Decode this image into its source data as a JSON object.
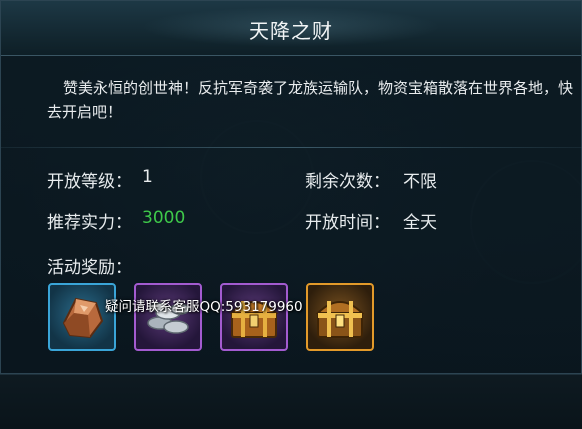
{
  "dialog": {
    "title": "天降之财",
    "description": "赞美永恒的创世神！反抗军奇袭了龙族运输队，物资宝箱散落在世界各地，快去开启吧！"
  },
  "info": {
    "open_level_label": "开放等级：",
    "open_level_value": "1",
    "remaining_label": "剩余次数：",
    "remaining_value": "不限",
    "power_label": "推荐实力：",
    "power_value": "3000",
    "time_label": "开放时间：",
    "time_value": "全天",
    "power_color": "#3ec94a"
  },
  "rewards": {
    "label": "活动奖励：",
    "items": [
      {
        "icon": "copper-ore-icon",
        "quality": "blue",
        "color": "#3aa5d8"
      },
      {
        "icon": "silver-coins-icon",
        "quality": "purple",
        "color": "#a35bd0"
      },
      {
        "icon": "treasure-chest-icon",
        "quality": "purple",
        "color": "#a35bd0"
      },
      {
        "icon": "treasure-chest-icon",
        "quality": "orange",
        "color": "#e39a2a"
      }
    ]
  },
  "watermark": {
    "contact_text": "疑问请联系客服QQ:593179960"
  }
}
